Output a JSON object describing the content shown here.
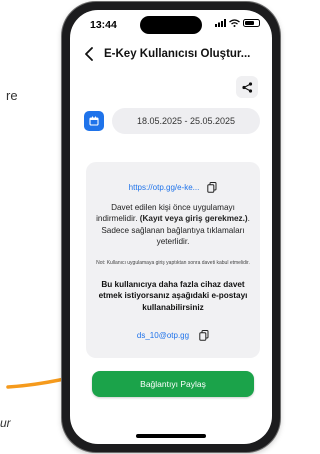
{
  "status_bar": {
    "time": "13:44"
  },
  "nav": {
    "title": "E-Key Kullanıcısı Oluştur..."
  },
  "date_range": "18.05.2025 - 25.05.2025",
  "invite_card": {
    "link": "https://otp.gg/e-ke...",
    "paragraph_before": "Davet edilen kişi önce uygulamayı indirmelidir. ",
    "paragraph_bold": "(Kayıt veya giriş gerekmez.)",
    "paragraph_after": ". Sadece sağlanan bağlantıya tıklamaları yeterlidir.",
    "note": "Not: Kullanıcı uygulamaya giriş yaptıktan sonra daveti kabul etmelidir.",
    "more_devices_text": "Bu kullanıcıya daha fazla cihaz davet etmek istiyorsanız aşağıdaki e-postayı kullanabilirsiniz",
    "email": "ds_10@otp.gg"
  },
  "share_button_label": "Bağlantıyı Paylaş",
  "page_edge_text": {
    "left_top": "re",
    "left_bottom": "ur"
  },
  "colors": {
    "accent_blue": "#1f73ea",
    "primary_green": "#1ba34a",
    "arrow_orange": "#f59a1c"
  },
  "icons": [
    "back-chevron-icon",
    "share-icon",
    "calendar-icon",
    "copy-icon",
    "wifi-icon",
    "signal-icon",
    "battery-icon"
  ]
}
